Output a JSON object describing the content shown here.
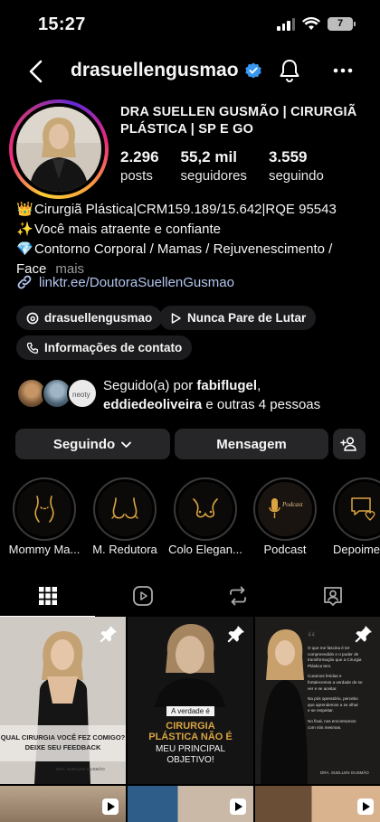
{
  "status_bar": {
    "time": "15:27",
    "battery": "7"
  },
  "header": {
    "username": "drasuellengusmao"
  },
  "profile": {
    "display_name": "DRA SUELLEN GUSMÃO | CIRURGIÃ PLÁSTICA | SP E GO",
    "stats": [
      {
        "value": "2.296",
        "label": "posts"
      },
      {
        "value": "55,2 mil",
        "label": "seguidores"
      },
      {
        "value": "3.559",
        "label": "seguindo"
      }
    ],
    "bio": {
      "line1_emoji": "👑",
      "line1": "Cirurgiã Plástica|CRM159.189/15.642|RQE 95543",
      "line2_emoji": "✨",
      "line2": "Você mais atraente e confiante",
      "line3_emoji": "💎",
      "line3": "Contorno Corporal / Mamas / Rejuvenescimento /",
      "line4": "Face",
      "more": "mais"
    },
    "link": "linktr.ee/DoutoraSuellenGusmao",
    "chips": {
      "threads": "drasuellengusmao",
      "reel": "Nunca Pare de Lutar",
      "contact": "Informações de contato"
    },
    "followed_by": {
      "prefix": "Seguido(a) por ",
      "user1": "fabiflugel",
      "sep": ",",
      "user2": "eddiedeoliveira",
      "suffix": " e outras 4 pessoas"
    },
    "buttons": {
      "following": "Seguindo",
      "message": "Mensagem"
    }
  },
  "highlights": [
    {
      "label": "Mommy Ma..."
    },
    {
      "label": "M. Redutora"
    },
    {
      "label": "Colo Elegan..."
    },
    {
      "label": "Podcast",
      "inner_text": "Podcast Vida"
    },
    {
      "label": "Depoime"
    }
  ],
  "posts": [
    {
      "caption_top": "QUAL CIRURGIA VOCÊ FEZ COMIGO?",
      "caption_bottom": "DEIXE SEU FEEDBACK",
      "tag": "DRA. SUELLEN GUSMÃO"
    },
    {
      "caption_top": "A verdade é",
      "caption_main": "CIRURGIA PLÁSTICA NÃO É",
      "caption_bottom": "MEU PRINCIPAL OBJETIVO!"
    },
    {
      "quote_lines": [
        "O que me fascina é ter",
        "compreendido e o poder de",
        "transformação que a Cirurgia",
        "Plástica tem.",
        "Curamos feridas e",
        "fortalecemos a verdade de se",
        "ver e se aceitar.",
        "Na pós operatório, percebo",
        "que aprendemos a se olhar",
        "e se respeitar.",
        "No final, nos encontramos",
        "com nós mesmas."
      ],
      "tag": "DRA. SUELLEN GUSMÃO"
    }
  ],
  "colors": {
    "background": "#000000",
    "button_bg": "#262628",
    "link": "#b3c6f0",
    "gold": "#d9a441",
    "verified": "#3897f0"
  }
}
